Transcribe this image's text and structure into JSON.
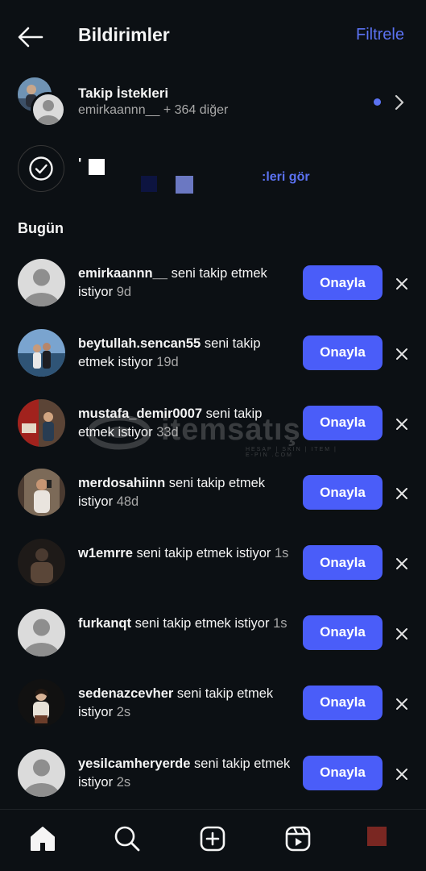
{
  "header": {
    "title": "Bildirimler",
    "filter_label": "Filtrele"
  },
  "follow_requests": {
    "title": "Takip İstekleri",
    "subtitle": "emirkaannn__ + 364 diğer"
  },
  "activity": {
    "prefix": "'",
    "link_label": ":leri gör"
  },
  "section": {
    "title": "Bugün"
  },
  "requests": [
    {
      "username": "emirkaannn__",
      "message": " seni takip etmek istiyor",
      "time": "9d",
      "avatar": "default",
      "confirm_label": "Onayla"
    },
    {
      "username": "beytullah.sencan55",
      "message": " seni takip etmek istiyor",
      "time": "19d",
      "avatar": "photo-sea",
      "confirm_label": "Onayla"
    },
    {
      "username": "mustafa_demir0007",
      "message": " seni takip etmek istiyor",
      "time": "33d",
      "avatar": "photo-street",
      "confirm_label": "Onayla"
    },
    {
      "username": "merdosahiinn",
      "message": " seni takip etmek istiyor",
      "time": "48d",
      "avatar": "photo-mirror",
      "confirm_label": "Onayla"
    },
    {
      "username": "w1emrre",
      "message": " seni takip etmek istiyor",
      "time": "1s",
      "avatar": "photo-dark",
      "confirm_label": "Onayla"
    },
    {
      "username": "furkanqt",
      "message": " seni takip etmek istiyor",
      "time": "1s",
      "avatar": "default",
      "confirm_label": "Onayla"
    },
    {
      "username": "sedenazcevher",
      "message": " seni takip etmek istiyor",
      "time": "2s",
      "avatar": "photo-portrait",
      "confirm_label": "Onayla"
    },
    {
      "username": "yesilcamheryerde",
      "message": " seni takip etmek istiyor",
      "time": "2s",
      "avatar": "default",
      "confirm_label": "Onayla"
    }
  ],
  "watermark": {
    "text": "itemsatış",
    "sub": "HESAP | SKIN | ITEM | E-PIN .COM"
  },
  "tabs": [
    "home-icon",
    "search-icon",
    "create-icon",
    "reels-icon",
    "profile-avatar"
  ],
  "colors": {
    "background": "#0c1014",
    "accent": "#5b72f2",
    "button": "#4a5df9",
    "secondary_text": "#a8a8a8"
  }
}
